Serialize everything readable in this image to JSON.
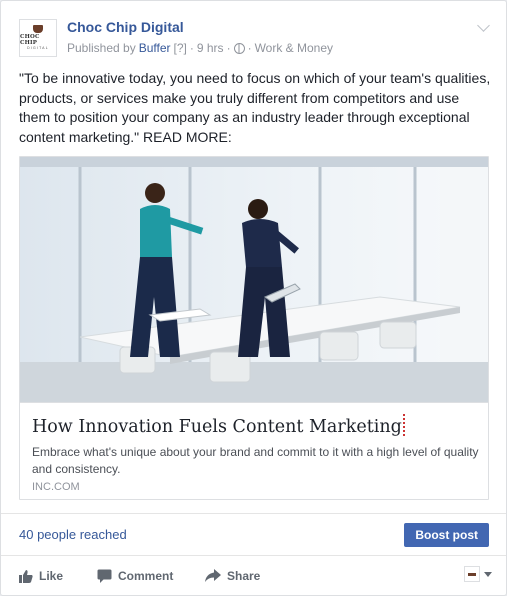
{
  "post": {
    "page_name": "Choc Chip Digital",
    "avatar_logo_top": "CHOC CHIP",
    "avatar_logo_bottom": "DIGITAL",
    "published_by_prefix": "Published by",
    "publisher": "Buffer",
    "help_marker": "[?]",
    "time": "9 hrs",
    "separator": "·",
    "category": "Work & Money",
    "text": "\"To be innovative today, you need to focus on which of your team's qualities, products, or services make you truly different from competitors and use them to position your company as an industry leader through exceptional content marketing.\" READ MORE:"
  },
  "link": {
    "title": "How Innovation Fuels Content Marketing",
    "description": "Embrace what's unique about your brand and commit to it with a high level of quality and consistency.",
    "domain": "INC.COM"
  },
  "insights": {
    "reach": "40 people reached",
    "boost_label": "Boost post"
  },
  "actions": {
    "like": "Like",
    "comment": "Comment",
    "share": "Share"
  },
  "colors": {
    "link_blue": "#365899",
    "boost_button": "#4267b2",
    "meta_gray": "#90949c"
  },
  "icons": [
    "globe-icon",
    "chevron-down-icon",
    "like-icon",
    "comment-icon",
    "share-icon",
    "caret-down-icon"
  ]
}
